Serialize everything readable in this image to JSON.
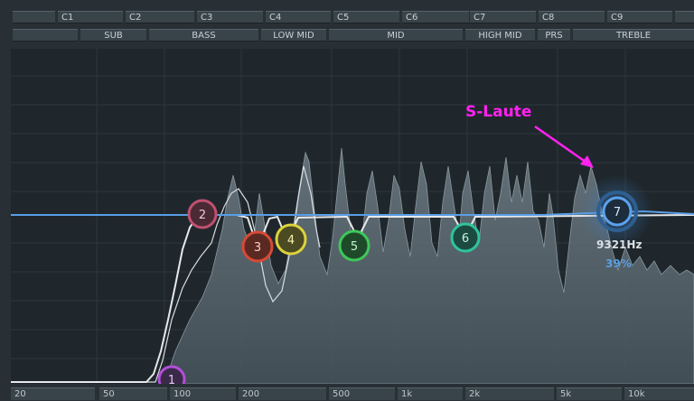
{
  "channels": [
    {
      "id": "",
      "label": ""
    },
    {
      "id": "c1",
      "label": "C1"
    },
    {
      "id": "c2",
      "label": "C2"
    },
    {
      "id": "c3",
      "label": "C3"
    },
    {
      "id": "c4",
      "label": "C4"
    },
    {
      "id": "c5",
      "label": "C5"
    },
    {
      "id": "c6",
      "label": "C6"
    },
    {
      "id": "c7",
      "label": "C7"
    },
    {
      "id": "c8",
      "label": "C8"
    },
    {
      "id": "c9",
      "label": "C9"
    },
    {
      "id": "",
      "label": ""
    }
  ],
  "bands": [
    "SUB",
    "BASS",
    "LOW MID",
    "MID",
    "HIGH MID",
    "PRS",
    "TREBLE"
  ],
  "x_axis": [
    "20",
    "50",
    "100",
    "200",
    "500",
    "1k",
    "2k",
    "5k",
    "10k"
  ],
  "annotation": "S-Laute",
  "selected": {
    "freq": "9321Hz",
    "amount": "39%"
  },
  "nodes": [
    {
      "n": "1",
      "color": "#b24fd8"
    },
    {
      "n": "2",
      "color": "#c05070"
    },
    {
      "n": "3",
      "color": "#d84a36"
    },
    {
      "n": "4",
      "color": "#dcd23a"
    },
    {
      "n": "5",
      "color": "#3ec85a"
    },
    {
      "n": "6",
      "color": "#2fc49c"
    },
    {
      "n": "7",
      "color": "#5aa2f0"
    }
  ],
  "colors": {
    "eq_line": "#5a9ee6",
    "curve": "#ededed",
    "annotation": "#ff22f0"
  }
}
